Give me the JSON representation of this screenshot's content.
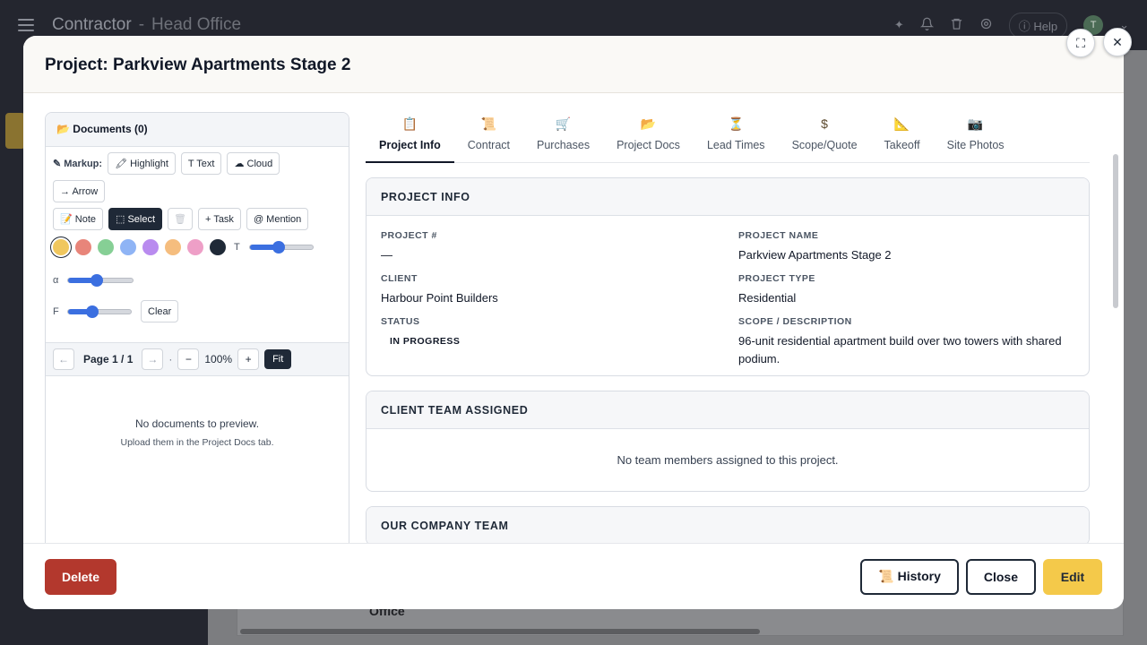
{
  "app": {
    "title": "Contractor",
    "separator": "-",
    "subtitle": "Head Office",
    "help_label": "Help",
    "avatar_initial": "T",
    "background_text": "Office"
  },
  "modal": {
    "title": "Project: Parkview Apartments Stage 2"
  },
  "documents": {
    "header": "📂 Documents (0)",
    "markup_label": "✎ Markup:",
    "tools": {
      "highlight": "🖍 Highlight",
      "text": "T Text",
      "cloud": "☁ Cloud",
      "arrow": "→ Arrow",
      "note": "📝 Note",
      "select": "⬚ Select",
      "trash": "🗑",
      "task": "+ Task",
      "mention": "@ Mention",
      "clear": "Clear"
    },
    "colors": [
      "#f0c75e",
      "#e8857a",
      "#86cf95",
      "#8fb4f5",
      "#b98bef",
      "#f5bd7e",
      "#ee9fc7",
      "#1f2937"
    ],
    "selected_color_index": 0,
    "slider_labels": {
      "thickness": "T",
      "opacity": "α",
      "font": "F"
    },
    "slider_levels": {
      "thickness": 0.45,
      "opacity": 0.45,
      "font": 0.38
    },
    "pager": {
      "prev": "←",
      "page_label": "Page 1 / 1",
      "next": "→",
      "dot": "·",
      "zoom_out": "−",
      "zoom": "100%",
      "zoom_in": "+",
      "fit": "Fit"
    },
    "empty_title": "No documents to preview.",
    "empty_subtitle": "Upload them in the Project Docs tab."
  },
  "tabs": [
    {
      "icon": "📋",
      "label": "Project Info",
      "active": true
    },
    {
      "icon": "📜",
      "label": "Contract"
    },
    {
      "icon": "🛒",
      "label": "Purchases"
    },
    {
      "icon": "📂",
      "label": "Project Docs"
    },
    {
      "icon": "⏳",
      "label": "Lead Times"
    },
    {
      "icon": "$",
      "label": "Scope/Quote"
    },
    {
      "icon": "📐",
      "label": "Takeoff"
    },
    {
      "icon": "📷",
      "label": "Site Photos"
    }
  ],
  "project_info": {
    "heading": "PROJECT INFO",
    "fields": {
      "project_no_label": "PROJECT #",
      "project_no": "—",
      "project_name_label": "PROJECT NAME",
      "project_name": "Parkview Apartments Stage 2",
      "client_label": "CLIENT",
      "client": "Harbour Point Builders",
      "project_type_label": "PROJECT TYPE",
      "project_type": "Residential",
      "status_label": "STATUS",
      "status": "IN PROGRESS",
      "scope_label": "SCOPE / DESCRIPTION",
      "scope": "96-unit residential apartment build over two towers with shared podium."
    }
  },
  "client_team": {
    "heading": "CLIENT TEAM ASSIGNED",
    "empty": "No team members assigned to this project."
  },
  "company_team": {
    "heading": "OUR COMPANY TEAM"
  },
  "footer": {
    "delete": "Delete",
    "history": "📜 History",
    "close": "Close",
    "edit": "Edit"
  },
  "colors": {
    "accent_yellow": "#f4c94a",
    "delete_red": "#b3382d",
    "dark": "#1f2937",
    "slider_blue": "#3b6fe0"
  }
}
